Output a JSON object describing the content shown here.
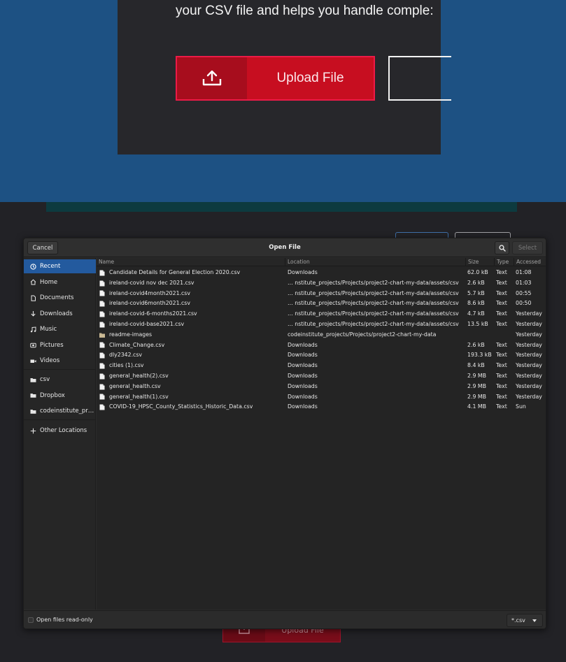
{
  "background": {
    "tagline": "your CSV file and helps you handle comple:",
    "upload_label": "Upload File",
    "upload_label_bottom": "Upload File"
  },
  "dialog": {
    "title": "Open File",
    "cancel_label": "Cancel",
    "select_label": "Select",
    "sidebar": [
      {
        "label": "Recent",
        "icon": "clock-icon"
      },
      {
        "label": "Home",
        "icon": "home-icon"
      },
      {
        "label": "Documents",
        "icon": "document-icon"
      },
      {
        "label": "Downloads",
        "icon": "download-icon"
      },
      {
        "label": "Music",
        "icon": "music-icon"
      },
      {
        "label": "Pictures",
        "icon": "camera-icon"
      },
      {
        "label": "Videos",
        "icon": "video-icon"
      },
      {
        "label": "csv",
        "icon": "folder-icon"
      },
      {
        "label": "Dropbox",
        "icon": "folder-icon"
      },
      {
        "label": "codeinstitute_pr…",
        "icon": "folder-icon"
      },
      {
        "label": "Other Locations",
        "icon": "plus-icon"
      }
    ],
    "columns": {
      "name": "Name",
      "location": "Location",
      "size": "Size",
      "type": "Type",
      "accessed": "Accessed"
    },
    "files": [
      {
        "name": "Candidate Details for General Election 2020.csv",
        "location": "Downloads",
        "size": "62.0 kB",
        "type": "Text",
        "accessed": "01:08",
        "kind": "file"
      },
      {
        "name": "ireland-covid nov dec 2021.csv",
        "location": "… nstitute_projects/Projects/project2-chart-my-data/assets/csv",
        "size": "2.6 kB",
        "type": "Text",
        "accessed": "01:03",
        "kind": "file"
      },
      {
        "name": "ireland-covid4month2021.csv",
        "location": "… nstitute_projects/Projects/project2-chart-my-data/assets/csv",
        "size": "5.7 kB",
        "type": "Text",
        "accessed": "00:55",
        "kind": "file"
      },
      {
        "name": "ireland-covid6month2021.csv",
        "location": "… nstitute_projects/Projects/project2-chart-my-data/assets/csv",
        "size": "8.6 kB",
        "type": "Text",
        "accessed": "00:50",
        "kind": "file"
      },
      {
        "name": "ireland-covid-6-months2021.csv",
        "location": "… nstitute_projects/Projects/project2-chart-my-data/assets/csv",
        "size": "4.7 kB",
        "type": "Text",
        "accessed": "Yesterday",
        "kind": "file"
      },
      {
        "name": "ireland-covid-base2021.csv",
        "location": "… nstitute_projects/Projects/project2-chart-my-data/assets/csv",
        "size": "13.5 kB",
        "type": "Text",
        "accessed": "Yesterday",
        "kind": "file"
      },
      {
        "name": "readme-images",
        "location": "codeinstitute_projects/Projects/project2-chart-my-data",
        "size": "",
        "type": "",
        "accessed": "Yesterday",
        "kind": "folder"
      },
      {
        "name": "Climate_Change.csv",
        "location": "Downloads",
        "size": "2.6 kB",
        "type": "Text",
        "accessed": "Yesterday",
        "kind": "file"
      },
      {
        "name": "dly2342.csv",
        "location": "Downloads",
        "size": "193.3 kB",
        "type": "Text",
        "accessed": "Yesterday",
        "kind": "file"
      },
      {
        "name": "cities (1).csv",
        "location": "Downloads",
        "size": "8.4 kB",
        "type": "Text",
        "accessed": "Yesterday",
        "kind": "file"
      },
      {
        "name": "general_health(2).csv",
        "location": "Downloads",
        "size": "2.9 MB",
        "type": "Text",
        "accessed": "Yesterday",
        "kind": "file"
      },
      {
        "name": "general_health.csv",
        "location": "Downloads",
        "size": "2.9 MB",
        "type": "Text",
        "accessed": "Yesterday",
        "kind": "file"
      },
      {
        "name": "general_health(1).csv",
        "location": "Downloads",
        "size": "2.9 MB",
        "type": "Text",
        "accessed": "Yesterday",
        "kind": "file"
      },
      {
        "name": "COVID-19_HPSC_County_Statistics_Historic_Data.csv",
        "location": "Downloads",
        "size": "4.1 MB",
        "type": "Text",
        "accessed": "Sun",
        "kind": "file"
      }
    ],
    "read_only_label": "Open files read-only",
    "filter_value": "*.csv"
  },
  "colors": {
    "page_blue": "#1d5183",
    "upload_red": "#c70e20",
    "selection_blue": "#235a9e",
    "dialog_bg": "#2b2b2b"
  }
}
